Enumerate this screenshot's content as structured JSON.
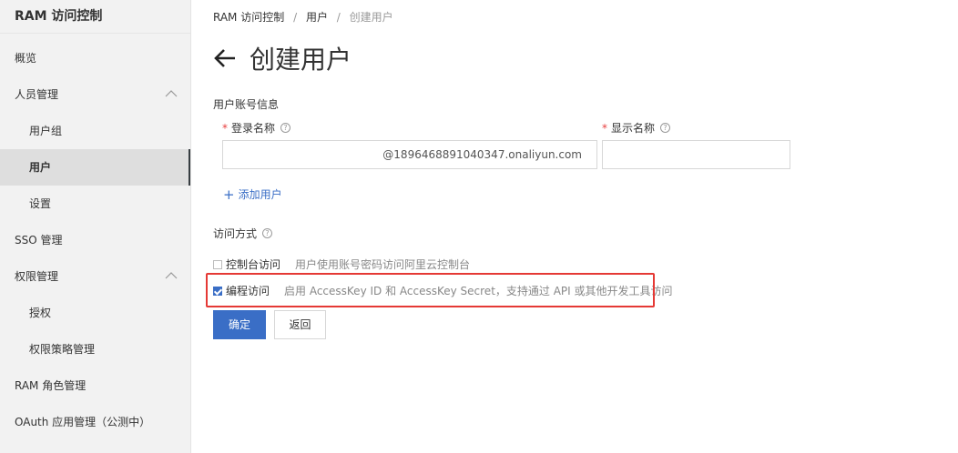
{
  "sidebar": {
    "title": "RAM 访问控制",
    "items": [
      {
        "label": "概览"
      },
      {
        "label": "人员管理"
      },
      {
        "label": "用户组"
      },
      {
        "label": "用户"
      },
      {
        "label": "设置"
      },
      {
        "label": "SSO 管理"
      },
      {
        "label": "权限管理"
      },
      {
        "label": "授权"
      },
      {
        "label": "权限策略管理"
      },
      {
        "label": "RAM 角色管理"
      },
      {
        "label": "OAuth 应用管理（公测中）"
      }
    ]
  },
  "breadcrumb": {
    "items": [
      "RAM 访问控制",
      "用户",
      "创建用户"
    ],
    "separator": "/"
  },
  "page": {
    "title": "创建用户",
    "back_icon": "arrow-left-icon"
  },
  "form": {
    "section_title": "用户账号信息",
    "login_name": {
      "label": "登录名称",
      "required_mark": "*",
      "help": "?",
      "value": "",
      "suffix": "@1896468891040347.onaliyun.com"
    },
    "display_name": {
      "label": "显示名称",
      "required_mark": "*",
      "help": "?",
      "value": ""
    },
    "add_user": {
      "plus": "+",
      "label": "添加用户"
    }
  },
  "access": {
    "title": "访问方式",
    "help": "?",
    "options": [
      {
        "label": "控制台访问",
        "desc": "用户使用账号密码访问阿里云控制台",
        "checked": false
      },
      {
        "label": "编程访问",
        "desc": "启用 AccessKey ID 和 AccessKey Secret，支持通过 API 或其他开发工具访问",
        "checked": true
      }
    ]
  },
  "buttons": {
    "confirm": "确定",
    "back": "返回"
  },
  "colors": {
    "primary": "#3a6ec6",
    "highlight": "#e53935",
    "required": "#e84040"
  }
}
